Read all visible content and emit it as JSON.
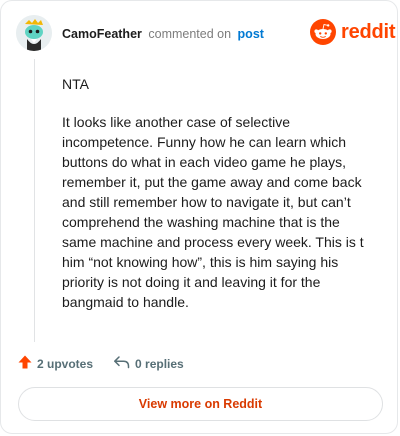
{
  "header": {
    "username": "CamoFeather",
    "action": "commented on",
    "post_link": "post"
  },
  "brand": {
    "wordmark": "reddit",
    "color": "#ff4500",
    "icon": "reddit-alien-icon"
  },
  "comment": {
    "paragraphs": [
      "NTA",
      "It looks like another case of selective incompetence. Funny how he can learn which buttons do what in each video game he plays, remember it, put the game away and come back and still remember how to navigate it, but can’t comprehend the washing machine that is the same machine and process every week. This is t him “not knowing how”, this is him saying his priority is not doing it and leaving it for the bangmaid to handle."
    ]
  },
  "footer": {
    "upvotes": "2 upvotes",
    "upvote_icon": "upvote-arrow-icon",
    "upvote_color": "#ff4500",
    "replies": "0 replies",
    "reply_icon": "reply-arrow-icon"
  },
  "cta": {
    "label": "View more on Reddit",
    "color": "#d93a00"
  }
}
